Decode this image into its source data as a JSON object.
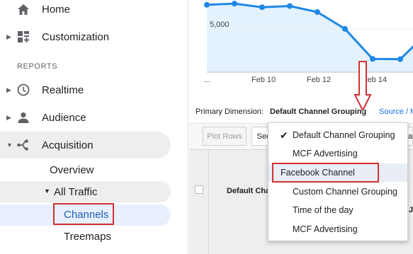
{
  "sidebar": {
    "items": [
      {
        "label": "Home",
        "icon": "home-icon"
      },
      {
        "label": "Customization",
        "icon": "dashboard-icon"
      }
    ],
    "section_label": "REPORTS",
    "report_items": [
      {
        "label": "Realtime",
        "icon": "clock-icon"
      },
      {
        "label": "Audience",
        "icon": "person-icon"
      },
      {
        "label": "Acquisition",
        "icon": "acquisition-icon"
      }
    ],
    "acquisition_sub": {
      "overview": "Overview",
      "all_traffic": "All Traffic",
      "channels": "Channels",
      "treemaps": "Treemaps"
    }
  },
  "chart_data": {
    "type": "line",
    "x_tick_labels": [
      "...",
      "Feb 10",
      "Feb 12",
      "Feb 14"
    ],
    "y_tick_label": "5,000",
    "values": [
      7600,
      7700,
      7400,
      7500,
      7000,
      5600,
      3100,
      3080,
      5300,
      7600
    ],
    "ylim": [
      2000,
      8000
    ],
    "series_color": "#1e88e5",
    "fill_color": "#e3f2fd"
  },
  "primary_dimension": {
    "label": "Primary Dimension:",
    "value": "Default Channel Grouping",
    "source_link": "Source / M"
  },
  "toolbar": {
    "plot_rows": "Plot Rows",
    "secondary": "Sec"
  },
  "table": {
    "column_header": "Default Cha",
    "right_head_top": "au",
    "right_head_mid": "Js"
  },
  "dropdown": {
    "items": [
      "Default Channel Grouping",
      "MCF Advertising",
      "Facebook Channel",
      "Custom Channel Grouping",
      "Time of the day",
      "MCF Advertising"
    ],
    "selected_index": 0,
    "highlight_index": 2
  },
  "colors": {
    "annotation_red": "#d32f2f",
    "link_blue": "#1a73e8",
    "active_pill": "#e8f0fe"
  }
}
